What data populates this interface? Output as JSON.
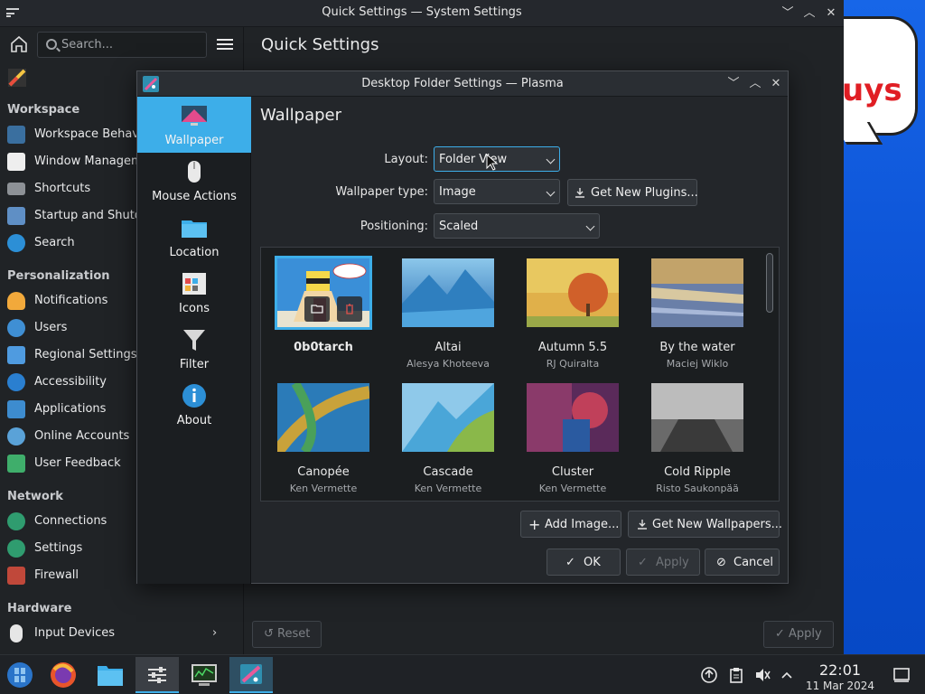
{
  "desktop": {
    "bubble_text": "uys"
  },
  "system_settings": {
    "title": "Quick Settings — System Settings",
    "search_placeholder": "Search...",
    "page_title": "Quick Settings",
    "reset_label": "Reset",
    "apply_label": "Apply",
    "sections": [
      {
        "label": "Workspace",
        "items": [
          "Workspace Behavior",
          "Window Management",
          "Shortcuts",
          "Startup and Shutdown",
          "Search"
        ]
      },
      {
        "label": "Personalization",
        "items": [
          "Notifications",
          "Users",
          "Regional Settings",
          "Accessibility",
          "Applications",
          "Online Accounts",
          "User Feedback"
        ]
      },
      {
        "label": "Network",
        "items": [
          "Connections",
          "Settings",
          "Firewall"
        ]
      },
      {
        "label": "Hardware",
        "items": [
          "Input Devices"
        ]
      }
    ]
  },
  "dialog": {
    "title": "Desktop Folder Settings — Plasma",
    "categories": [
      "Wallpaper",
      "Mouse Actions",
      "Location",
      "Icons",
      "Filter",
      "About"
    ],
    "heading": "Wallpaper",
    "layout": {
      "label": "Layout:",
      "value": "Folder View"
    },
    "wallpaper_type": {
      "label": "Wallpaper type:",
      "value": "Image"
    },
    "get_new_plugins": "Get New Plugins...",
    "positioning": {
      "label": "Positioning:",
      "value": "Scaled"
    },
    "wallpapers": [
      {
        "name": "0b0tarch",
        "author": ""
      },
      {
        "name": "Altai",
        "author": "Alesya Khoteeva"
      },
      {
        "name": "Autumn 5.5",
        "author": "RJ Quiralta"
      },
      {
        "name": "By the water",
        "author": "Maciej Wiklo"
      },
      {
        "name": "Canopée",
        "author": "Ken Vermette"
      },
      {
        "name": "Cascade",
        "author": "Ken Vermette"
      },
      {
        "name": "Cluster",
        "author": "Ken Vermette"
      },
      {
        "name": "Cold Ripple",
        "author": "Risto Saukonpää"
      }
    ],
    "add_image": "Add Image...",
    "get_new_wallpapers": "Get New Wallpapers...",
    "ok": "OK",
    "apply": "Apply",
    "cancel": "Cancel"
  },
  "clock": {
    "time": "22:01",
    "date": "11 Mar 2024"
  },
  "colors": {
    "accent": "#3daee9",
    "window_bg": "#202326",
    "dialog_bg": "#23262a"
  }
}
